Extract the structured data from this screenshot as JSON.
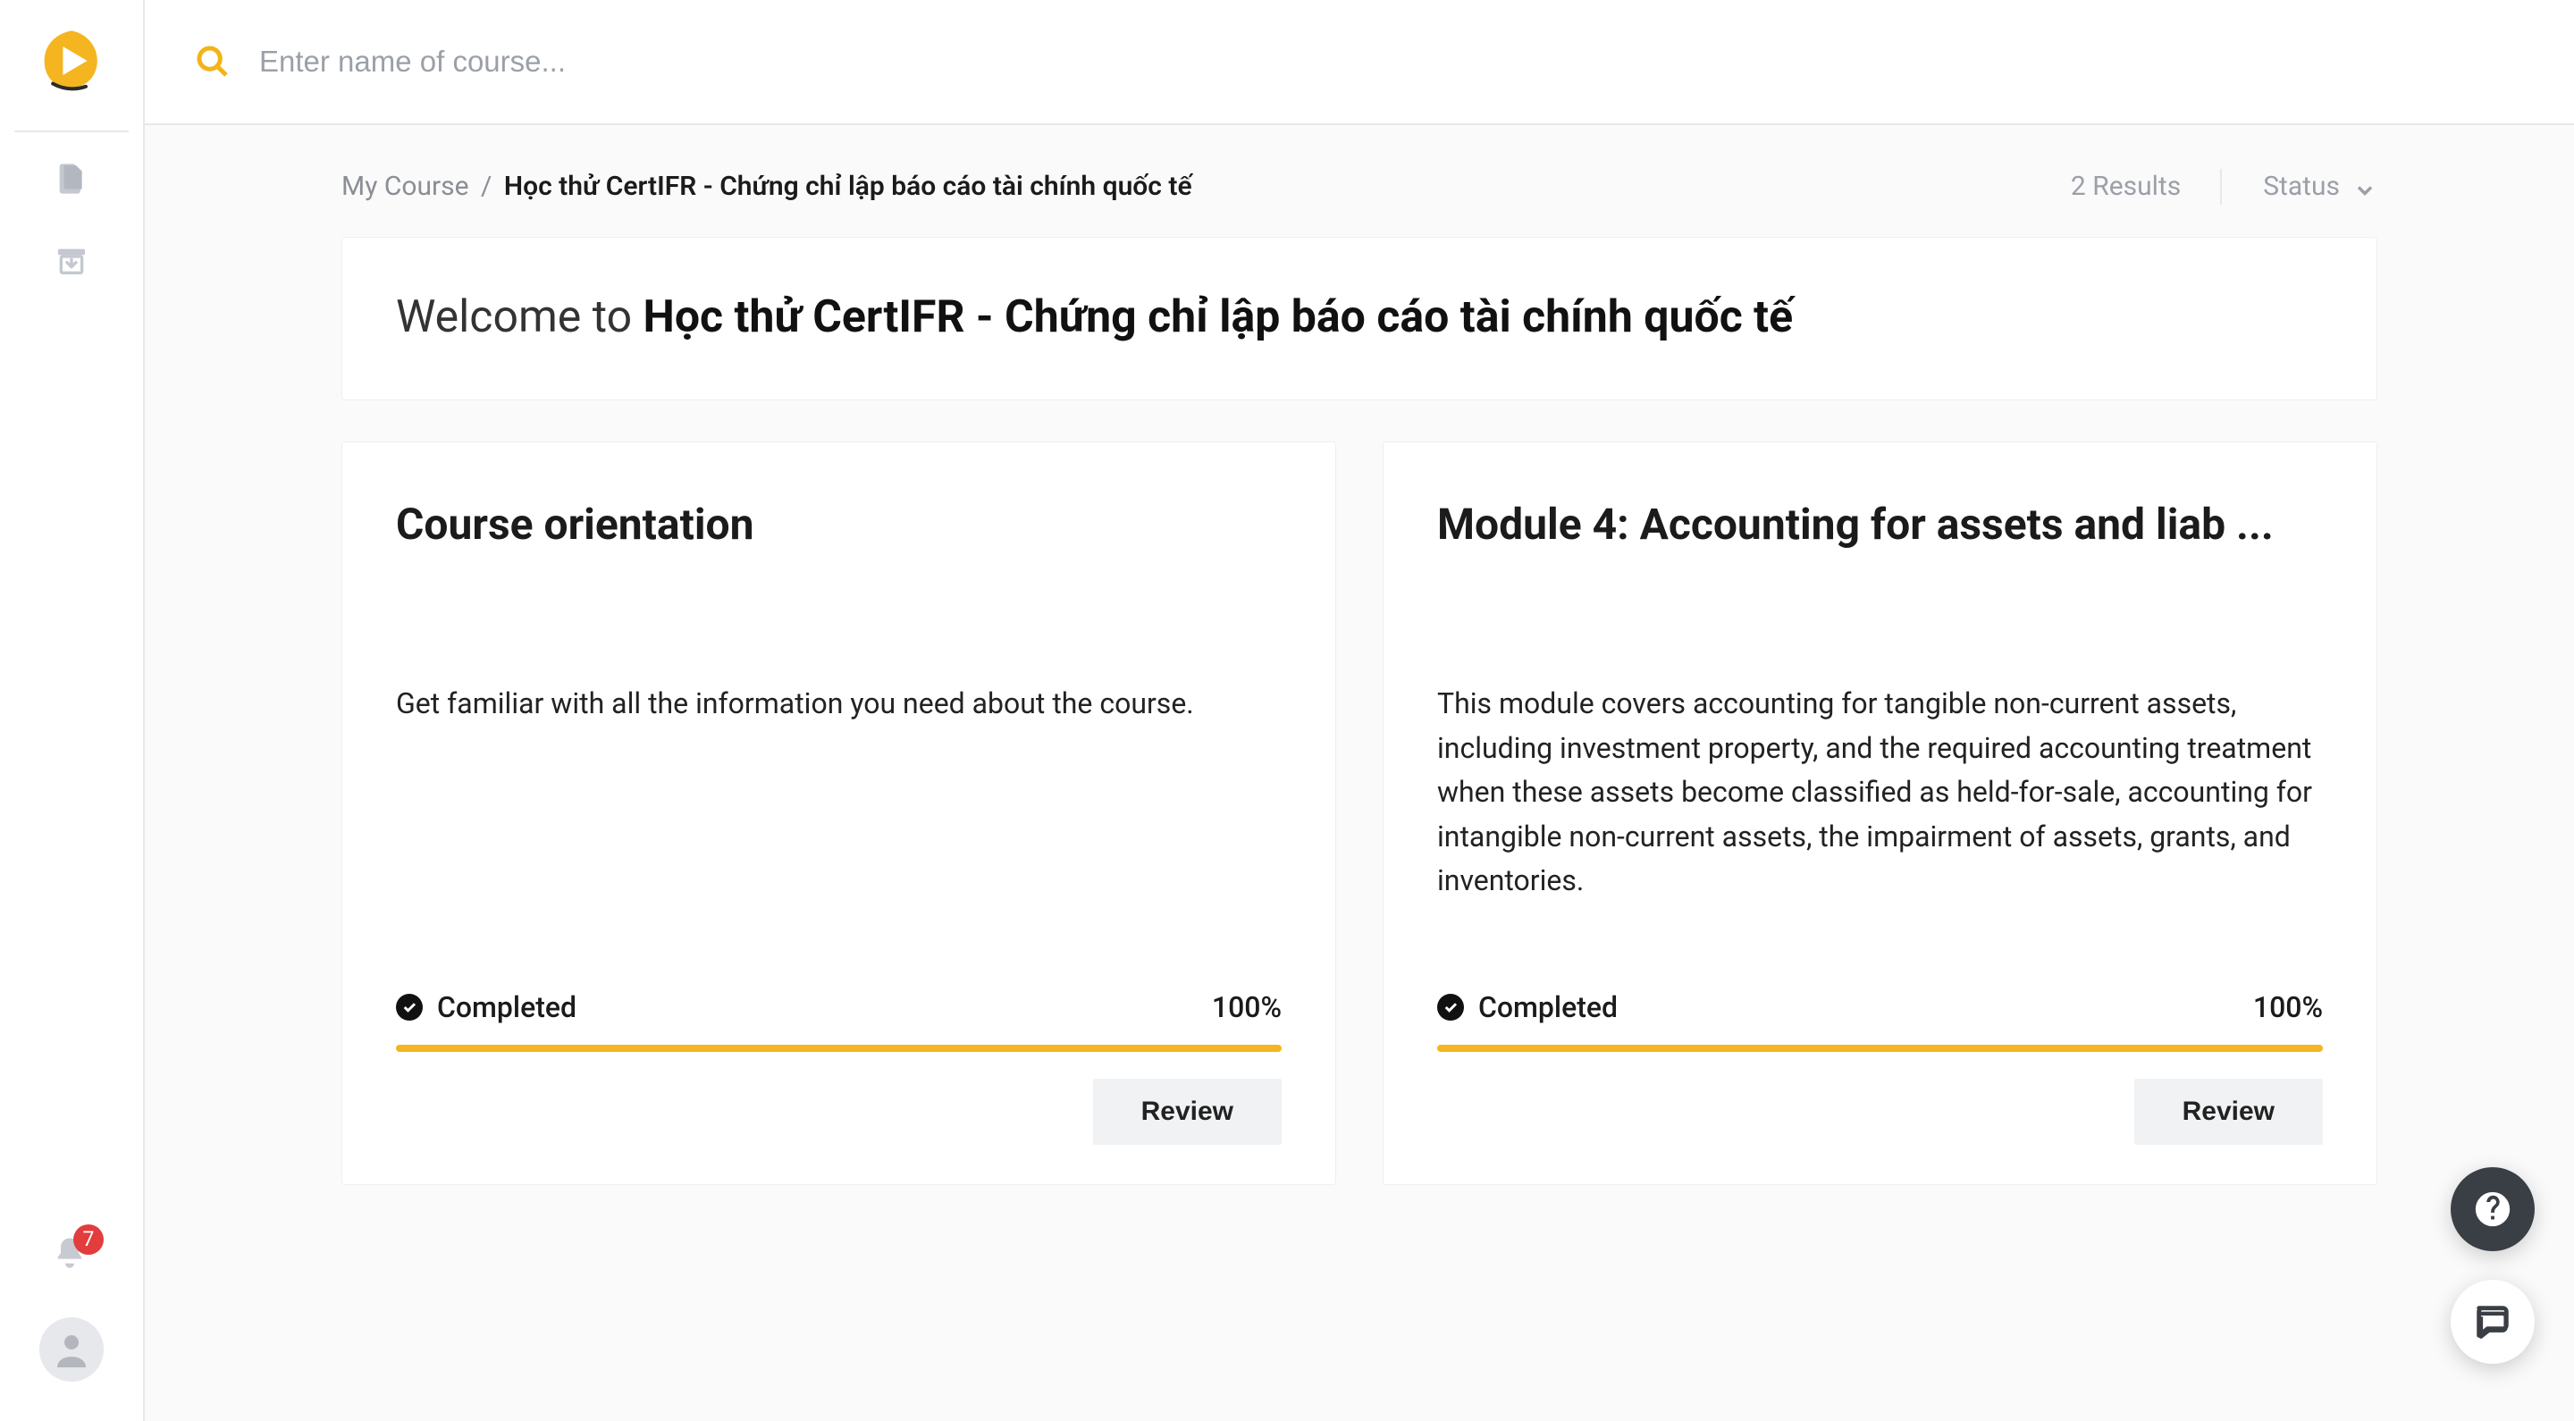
{
  "sidebar": {
    "notifications_count": "7"
  },
  "search": {
    "placeholder": "Enter name of course..."
  },
  "breadcrumb": {
    "root": "My Course",
    "separator": "/",
    "current": "Học thử CertIFR - Chứng chỉ lập báo cáo tài chính quốc tế"
  },
  "filter": {
    "results_text": "2 Results",
    "status_label": "Status"
  },
  "welcome": {
    "prefix": "Welcome to ",
    "title": "Học thử CertIFR - Chứng chỉ lập báo cáo tài chính quốc tế"
  },
  "cards": [
    {
      "title": "Course orientation",
      "description": "Get familiar with all the information you need about the course.",
      "status_label": "Completed",
      "percent_text": "100%",
      "percent": 100,
      "button": "Review"
    },
    {
      "title": "Module 4: Accounting for assets and liab ...",
      "description": "This module covers accounting for tangible non-current assets, including investment property, and the required accounting treatment when these assets become classified as held-for-sale, accounting for intangible non-current assets, the impairment of assets, grants, and inventories.",
      "status_label": "Completed",
      "percent_text": "100%",
      "percent": 100,
      "button": "Review"
    }
  ]
}
